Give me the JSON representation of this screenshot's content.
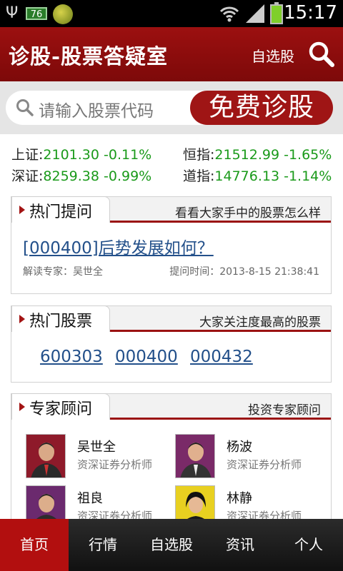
{
  "status_bar": {
    "battery_small_label": "76",
    "time": "15:17"
  },
  "header": {
    "title": "诊股-股票答疑室",
    "watchlist_label": "自选股"
  },
  "search": {
    "placeholder": "请输入股票代码",
    "diagnose_button": "免费诊股"
  },
  "indices": [
    {
      "label": "上证:",
      "value": "2101.30 -0.11%"
    },
    {
      "label": "恒指:",
      "value": "21512.99 -1.65%"
    },
    {
      "label": "深证:",
      "value": "8259.38 -0.99%"
    },
    {
      "label": "道指:",
      "value": "14776.13 -1.14%"
    }
  ],
  "hot_questions": {
    "title": "热门提问",
    "subtitle": "看看大家手中的股票怎么样",
    "question": "[000400]后势发展如何？",
    "expert": "解读专家：吴世全",
    "asked_time": "提问时间：2013-8-15 21:38:41"
  },
  "hot_stocks": {
    "title": "热门股票",
    "subtitle": "大家关注度最高的股票",
    "codes": [
      "600303",
      "000400",
      "000432"
    ]
  },
  "experts": {
    "title": "专家顾问",
    "subtitle": "投资专家顾问",
    "items": [
      {
        "name": "吴世全",
        "role": "资深证券分析师"
      },
      {
        "name": "杨波",
        "role": "资深证券分析师"
      },
      {
        "name": "祖良",
        "role": "资深证券分析师"
      },
      {
        "name": "林静",
        "role": "资深证券分析师"
      }
    ]
  },
  "bottom_nav": [
    "首页",
    "行情",
    "自选股",
    "资讯",
    "个人"
  ]
}
